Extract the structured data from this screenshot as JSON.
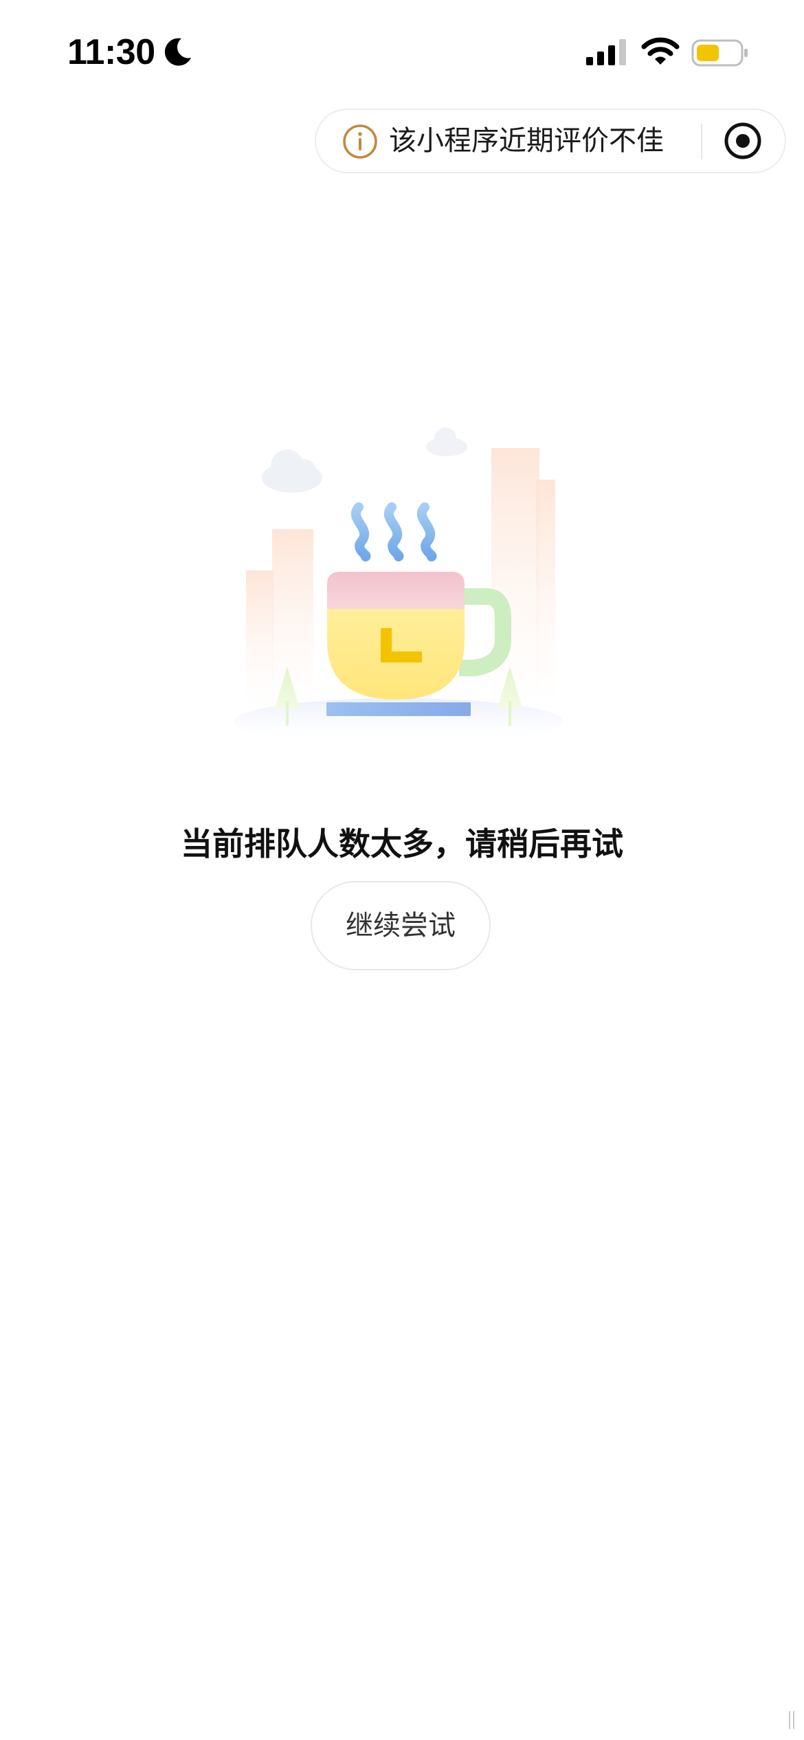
{
  "status_bar": {
    "time": "11:30",
    "icons": [
      "moon-icon",
      "signal-icon",
      "wifi-icon",
      "battery-icon"
    ],
    "battery_color": "#f5c400"
  },
  "capsule": {
    "warning_text": "该小程序近期评价不佳",
    "info_icon": "info-icon",
    "info_icon_color": "#c5873c",
    "action_icon": "target-icon"
  },
  "illustration": {
    "icon": "coffee-cup-illustration"
  },
  "main": {
    "message": "当前排队人数太多，请稍后再试",
    "retry_button_label": "继续尝试"
  }
}
